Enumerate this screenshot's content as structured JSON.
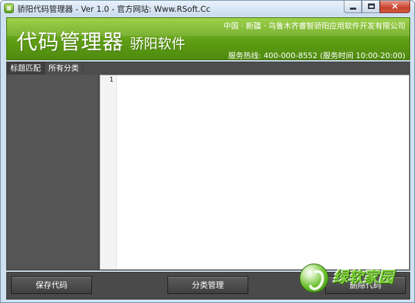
{
  "window": {
    "title": "骄阳代码管理器 - Ver 1.0 - 官方网站: Www.RSoft.Cc",
    "controls": {
      "close_label": "×"
    }
  },
  "banner": {
    "title": "代码管理器",
    "subtitle": "骄阳软件",
    "info": "中国 · 新疆 · 乌鲁木齐睿智骄阳应用软件开发有限公司",
    "hotline": "服务热线: 400-000-8552 (服务时间 10:00-20:00)"
  },
  "tabs": [
    {
      "label": "标题匹配"
    },
    {
      "label": "所有分类"
    }
  ],
  "editor": {
    "line_numbers": [
      "1"
    ],
    "content": ""
  },
  "buttons": {
    "save": "保存代码",
    "category": "分类管理",
    "delete": "删除代码"
  },
  "watermark": {
    "text": "绿软家园"
  },
  "colors": {
    "banner_green": "#6aa81c",
    "panel_dark": "#555555",
    "titlebar": "#d6e5f4"
  }
}
